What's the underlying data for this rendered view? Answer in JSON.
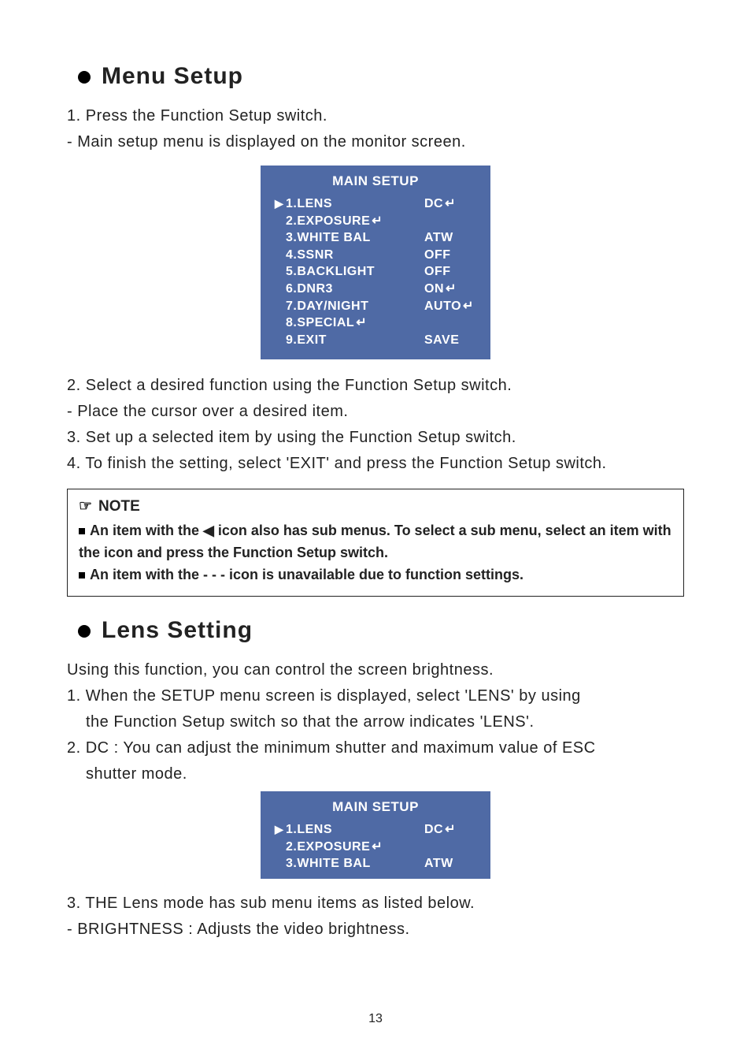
{
  "sections": {
    "menuSetup": {
      "heading": "Menu Setup",
      "lines": {
        "l1": "1. Press the Function Setup switch.",
        "l2": "- Main setup menu is displayed on the monitor screen.",
        "l3": "2. Select a desired function using the Function Setup switch.",
        "l4": "- Place the cursor over a desired item.",
        "l5": "3. Set up a selected item by using the Function Setup switch.",
        "l6": "4. To finish the setting, select 'EXIT' and press the Function Setup switch."
      }
    },
    "note": {
      "title": "NOTE",
      "line1_pre": "An item with the ",
      "line1_post": " icon also has sub menus. To select a sub menu, select an item with the icon and press the Function Setup switch.",
      "line2": "An item with the - - - icon is unavailable due to function settings."
    },
    "lensSetting": {
      "heading": "Lens Setting",
      "intro": "Using this function, you can control the screen brightness.",
      "l1a": "1. When the SETUP menu screen is displayed, select 'LENS' by using",
      "l1b": "the Function Setup switch so that the arrow indicates 'LENS'.",
      "l2a": "2. DC : You can adjust the minimum shutter and maximum value of ESC",
      "l2b": "shutter mode.",
      "l3": "3. THE Lens mode has sub menu items as listed below.",
      "l4": "- BRIGHTNESS : Adjusts the video brightness."
    }
  },
  "osd1": {
    "title": "MAIN SETUP",
    "rows": [
      {
        "cursor": "▶",
        "label": "1.LENS",
        "value": "DC",
        "enter": true
      },
      {
        "cursor": "",
        "label": "2.EXPOSURE",
        "value": "",
        "enter": true,
        "enterAfterLabel": true
      },
      {
        "cursor": "",
        "label": "3.WHITE BAL",
        "value": "ATW",
        "enter": false
      },
      {
        "cursor": "",
        "label": "4.SSNR",
        "value": "OFF",
        "enter": false
      },
      {
        "cursor": "",
        "label": "5.BACKLIGHT",
        "value": "OFF",
        "enter": false
      },
      {
        "cursor": "",
        "label": "6.DNR3",
        "value": "ON",
        "enter": true
      },
      {
        "cursor": "",
        "label": "7.DAY/NIGHT",
        "value": "AUTO",
        "enter": true
      },
      {
        "cursor": "",
        "label": "8.SPECIAL",
        "value": "",
        "enter": true,
        "enterAfterLabel": true
      },
      {
        "cursor": "",
        "label": "9.EXIT",
        "value": "SAVE",
        "enter": false
      }
    ]
  },
  "osd2": {
    "title": "MAIN SETUP",
    "rows": [
      {
        "cursor": "▶",
        "label": "1.LENS",
        "value": "DC",
        "enter": true
      },
      {
        "cursor": "",
        "label": "2.EXPOSURE",
        "value": "",
        "enter": true,
        "enterAfterLabel": true
      },
      {
        "cursor": "",
        "label": "3.WHITE BAL",
        "value": "ATW",
        "enter": false
      }
    ]
  },
  "pageNumber": "13",
  "glyphs": {
    "hand": "☞",
    "left": "◀",
    "enter": "↵"
  }
}
